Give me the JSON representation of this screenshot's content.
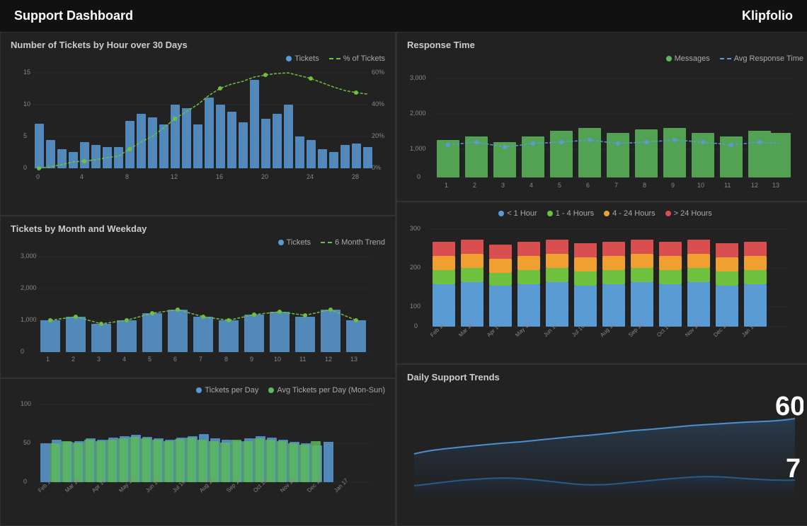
{
  "header": {
    "title": "Support Dashboard",
    "logo": "Klipfolio"
  },
  "charts": {
    "topLeft": {
      "title": "Number of Tickets by Hour over 30 Days",
      "legend": [
        {
          "label": "Tickets",
          "color": "#5b9bd5",
          "type": "dot"
        },
        {
          "label": "% of Tickets",
          "color": "#70c040",
          "type": "line"
        }
      ]
    },
    "midLeft": {
      "title": "Tickets by Month and Weekday",
      "legend": [
        {
          "label": "Tickets",
          "color": "#5b9bd5",
          "type": "dot"
        },
        {
          "label": "6 Month Trend",
          "color": "#70c040",
          "type": "line"
        }
      ]
    },
    "bottomLeft": {
      "legend": [
        {
          "label": "Tickets per Day",
          "color": "#5b9bd5",
          "type": "dot"
        },
        {
          "label": "Avg Tickets per Day (Mon-Sun)",
          "color": "#5cb85c",
          "type": "dot"
        }
      ]
    },
    "topRight": {
      "title": "Response Time",
      "legend": [
        {
          "label": "Messages",
          "color": "#5cb85c",
          "type": "dot"
        },
        {
          "label": "Avg Response Time",
          "color": "#5b9bd5",
          "type": "line"
        }
      ]
    },
    "midRight": {
      "legend": [
        {
          "label": "< 1 Hour",
          "color": "#5b9bd5"
        },
        {
          "label": "1 - 4 Hours",
          "color": "#70c040"
        },
        {
          "label": "4 - 24 Hours",
          "color": "#f0a030"
        },
        {
          "label": "> 24 Hours",
          "color": "#d94f4f"
        }
      ]
    },
    "bottomRight": {
      "title": "Daily Support Trends",
      "value1": "60",
      "value2": "7"
    }
  }
}
